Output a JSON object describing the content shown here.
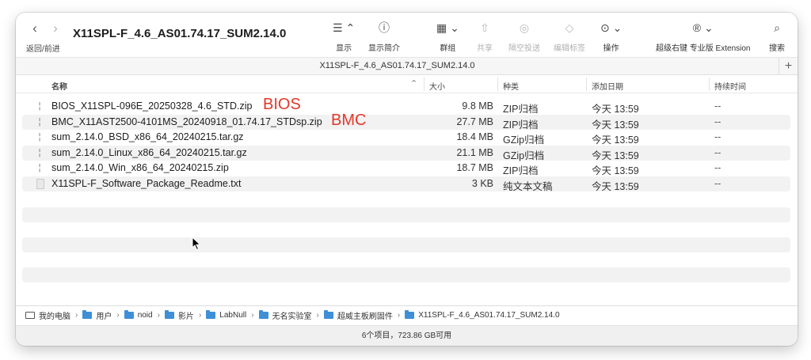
{
  "nav": {
    "back": "‹",
    "forward": "›",
    "label": "返回/前进"
  },
  "window_title": "X11SPL-F_4.6_AS01.74.17_SUM2.14.0",
  "toolbar": {
    "display": {
      "icon": "list-view-icon",
      "glyph": "☰ ⌃",
      "label": "显示"
    },
    "display_intro": {
      "icon": "info-icon",
      "glyph": "ⓘ",
      "label": "显示简介"
    },
    "group": {
      "icon": "grid-group-icon",
      "glyph": "▦ ⌄",
      "label": "群组"
    },
    "share": {
      "icon": "share-icon",
      "glyph": "⇧",
      "label": "共享"
    },
    "airdrop": {
      "icon": "airdrop-icon",
      "glyph": "◎",
      "label": "隔空投送"
    },
    "tags": {
      "icon": "tag-icon",
      "glyph": "◇",
      "label": "编辑标签"
    },
    "actions": {
      "icon": "ellipsis-circle-icon",
      "glyph": "⊙ ⌄",
      "label": "操作"
    },
    "superright": {
      "icon": "registered-icon",
      "glyph": "® ⌄",
      "label": "超级右键 专业版 Extension"
    },
    "search": {
      "icon": "search-icon",
      "glyph": "⌕",
      "label": "搜索"
    }
  },
  "tab": {
    "title": "X11SPL-F_4.6_AS01.74.17_SUM2.14.0",
    "add": "+"
  },
  "columns": {
    "name": "名称",
    "size": "大小",
    "kind": "种类",
    "date_added": "添加日期",
    "duration": "持续时间"
  },
  "files": [
    {
      "name": "BIOS_X11SPL-096E_20250328_4.6_STD.zip",
      "size": "9.8 MB",
      "kind": "ZIP归档",
      "date": "今天 13:59",
      "duration": "--",
      "icon": "archive-icon",
      "annotation": "BIOS"
    },
    {
      "name": "BMC_X11AST2500-4101MS_20240918_01.74.17_STDsp.zip",
      "size": "27.7 MB",
      "kind": "ZIP归档",
      "date": "今天 13:59",
      "duration": "--",
      "icon": "archive-icon",
      "annotation": "BMC"
    },
    {
      "name": "sum_2.14.0_BSD_x86_64_20240215.tar.gz",
      "size": "18.4 MB",
      "kind": "GZip归档",
      "date": "今天 13:59",
      "duration": "--",
      "icon": "archive-icon",
      "annotation": ""
    },
    {
      "name": "sum_2.14.0_Linux_x86_64_20240215.tar.gz",
      "size": "21.1 MB",
      "kind": "GZip归档",
      "date": "今天 13:59",
      "duration": "--",
      "icon": "archive-icon",
      "annotation": ""
    },
    {
      "name": "sum_2.14.0_Win_x86_64_20240215.zip",
      "size": "18.7 MB",
      "kind": "ZIP归档",
      "date": "今天 13:59",
      "duration": "--",
      "icon": "archive-icon",
      "annotation": ""
    },
    {
      "name": "X11SPL-F_Software_Package_Readme.txt",
      "size": "3 KB",
      "kind": "纯文本文稿",
      "date": "今天 13:59",
      "duration": "--",
      "icon": "text-file-icon",
      "annotation": ""
    }
  ],
  "path": [
    "我的电脑",
    "用户",
    "noid",
    "影片",
    "LabNull",
    "无名实验室",
    "超威主板刷固件",
    "X11SPL-F_4.6_AS01.74.17_SUM2.14.0"
  ],
  "status": "6个项目，723.86 GB可用",
  "colors": {
    "annotation_red": "#e2382a",
    "folder_blue": "#3f8fd8",
    "stripe_gray": "#f2f2f2"
  }
}
